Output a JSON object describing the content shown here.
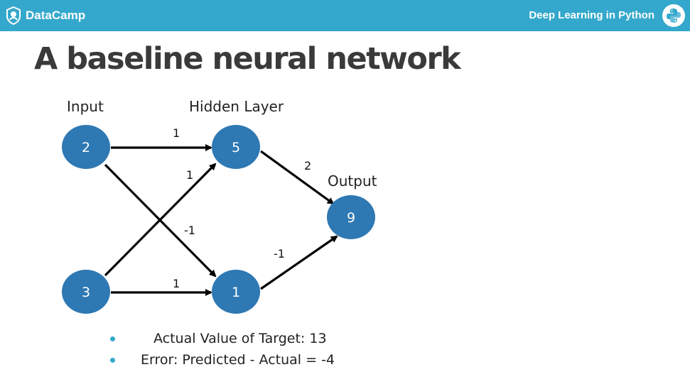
{
  "header": {
    "brand": "DataCamp",
    "course": "Deep Learning in Python"
  },
  "slide": {
    "title": "A baseline neural network"
  },
  "diagram": {
    "layer_labels": {
      "input": "Input",
      "hidden": "Hidden Layer",
      "output": "Output"
    },
    "nodes": {
      "input_top": "2",
      "input_bottom": "3",
      "hidden_top": "5",
      "hidden_bottom": "1",
      "output": "9"
    },
    "weights": {
      "in_top_to_hid_top": "1",
      "in_bottom_to_hid_top": "1",
      "in_top_to_hid_bottom": "-1",
      "in_bottom_to_hid_bottom": "1",
      "hid_top_to_out": "2",
      "hid_bottom_to_out": "-1"
    },
    "colors": {
      "node_fill": "#2e78b3",
      "edge": "#000000"
    }
  },
  "bullets": [
    "Actual Value of Target: 13",
    "Error: Predicted - Actual = -4"
  ],
  "colors": {
    "header_bg": "#34a8cc",
    "title_text": "#3a3a3a"
  }
}
